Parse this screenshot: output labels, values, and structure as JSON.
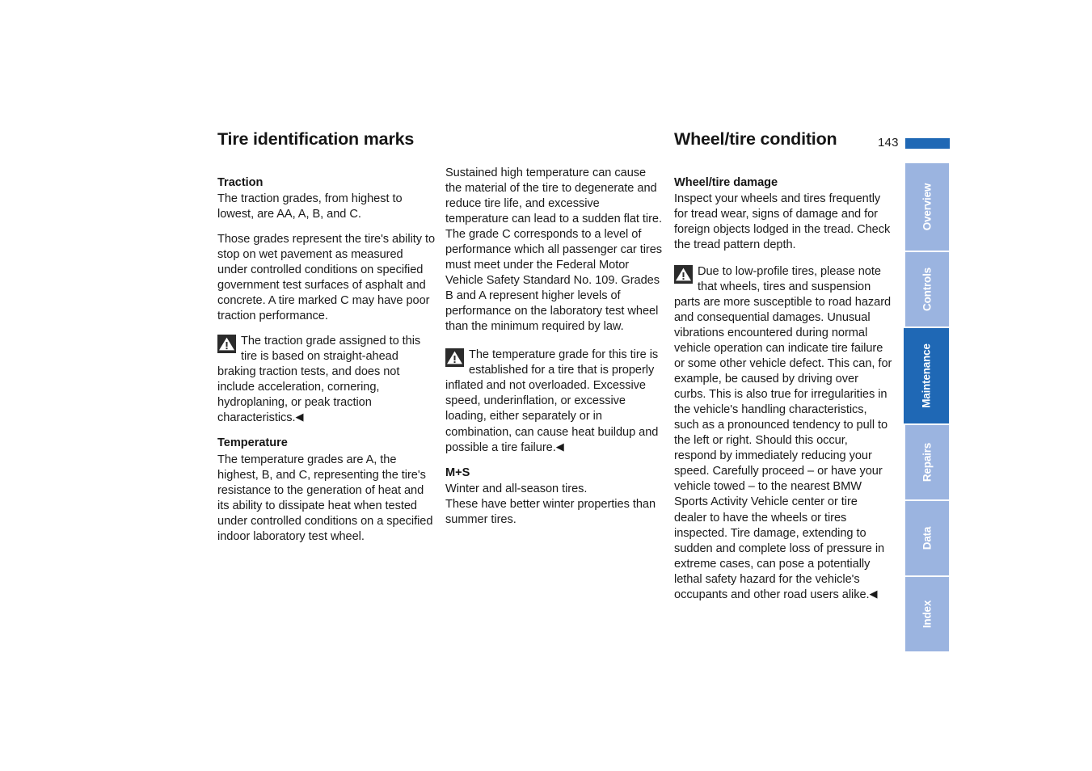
{
  "page": {
    "number": "143",
    "accent_color": "#1f68b5",
    "tab_inactive_color": "#9bb4e0"
  },
  "columns": {
    "col1": {
      "title": "Tire identification marks",
      "sections": [
        {
          "heading": "Traction",
          "paragraphs": [
            "The traction grades, from highest to lowest, are AA, A, B, and C.",
            "Those grades represent the tire's ability to stop on wet pavement as measured under controlled conditions on specified government test surfaces of asphalt and concrete. A tire marked C may have poor traction performance."
          ],
          "warning": "The traction grade assigned to this tire is based on straight-ahead braking traction tests, and does not include acceleration, cornering, hydroplaning, or peak traction characteristics."
        },
        {
          "heading": "Temperature",
          "paragraphs": [
            "The temperature grades are A, the highest, B, and C, representing the tire's resistance to the generation of heat and its ability to dissipate heat when tested under controlled conditions on a specified indoor laboratory test wheel."
          ]
        }
      ]
    },
    "col2": {
      "paragraphs": [
        "Sustained high temperature can cause the material of the tire to degenerate and reduce tire life, and excessive temperature can lead to a sudden flat tire. The grade C corresponds to a level of performance which all passenger car tires must meet under the Federal Motor Vehicle Safety Standard No. 109. Grades B and A represent higher levels of performance on the laboratory test wheel than the minimum required by law."
      ],
      "warning": "The temperature grade for this tire is established for a tire that is properly inflated and not overloaded. Excessive speed, underinflation, or excessive loading, either separately or in combination, can cause heat buildup and possible a tire failure.",
      "sections": [
        {
          "heading": "M+S",
          "paragraphs": [
            "Winter and all-season tires.",
            "These have better winter properties than summer tires."
          ]
        }
      ]
    },
    "col3": {
      "title": "Wheel/tire condition",
      "sections": [
        {
          "heading": "Wheel/tire damage",
          "paragraphs": [
            "Inspect your wheels and tires frequently for tread wear, signs of damage and for foreign objects lodged in the tread. Check the tread pattern depth."
          ],
          "warning": "Due to low-profile tires, please note that wheels, tires and suspension parts are more susceptible to road hazard and consequential damages. Unusual vibrations encountered during normal vehicle operation can indicate tire failure or some other vehicle defect. This can, for example, be caused by driving over curbs. This is also true for irregularities in the vehicle's handling characteristics, such as a pronounced tendency to pull to the left or right. Should this occur, respond by immediately reducing your speed. Carefully proceed – or have your vehicle towed – to the nearest BMW Sports Activity Vehicle center or tire dealer to have the wheels or tires inspected. Tire damage, extending to sudden and complete loss of pressure in extreme cases, can pose a potentially lethal safety hazard for the vehicle's occupants and other road users alike."
        }
      ]
    }
  },
  "warning_end_marker": "◀",
  "tabs": [
    {
      "label": "Overview",
      "active": false
    },
    {
      "label": "Controls",
      "active": false
    },
    {
      "label": "Maintenance",
      "active": true
    },
    {
      "label": "Repairs",
      "active": false
    },
    {
      "label": "Data",
      "active": false
    },
    {
      "label": "Index",
      "active": false
    }
  ]
}
